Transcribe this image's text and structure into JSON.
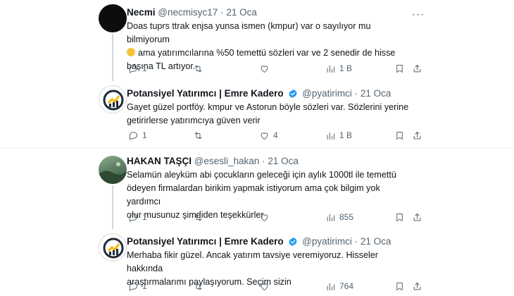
{
  "tweets": [
    {
      "name": "Necmi",
      "handle": "@necmisyc17",
      "sep": "·",
      "date": "21 Oca",
      "avatar": "black-avatar",
      "text_lines": [
        "Doas tuprs ttrak enjsa yunsa ismen (kmpur) var o sayılıyor mu bilmiyorum",
        "ama yatırımcılarına %50 temettü sözleri var ve 2 senedir de hisse",
        "başına TL artıyor."
      ],
      "emoji": "grinning-sweat-emoji",
      "reply_count": "1",
      "retweet_count": "",
      "like_count": "",
      "view_count": "1 B"
    },
    {
      "name": "Potansiyel Yatırımcı | Emre Kadero",
      "handle": "@pyatirimci",
      "sep": "·",
      "date": "21 Oca",
      "avatar": "logo-avatar",
      "verified": true,
      "text_lines": [
        "Gayet güzel portföy. kmpur ve Astorun böyle sözleri var. Sözlerini yerine",
        "getirirlerse yatırımcıya güven verir"
      ],
      "reply_count": "1",
      "retweet_count": "",
      "like_count": "4",
      "view_count": "1 B"
    },
    {
      "name": "HAKAN TAŞÇI",
      "handle": "@esesli_hakan",
      "sep": "·",
      "date": "21 Oca",
      "avatar": "landscape-avatar",
      "text_lines": [
        "Selamün aleyküm abi çocukların geleceği için aylık 1000tl ile temettü",
        "ödeyen firmalardan birikim yapmak istiyorum ama çok bilgim yok yardımcı",
        "olur musunuz şimdiden teşekkürler"
      ],
      "reply_count": "1",
      "retweet_count": "",
      "like_count": "",
      "view_count": "855"
    },
    {
      "name": "Potansiyel Yatırımcı | Emre Kadero",
      "handle": "@pyatirimci",
      "sep": "·",
      "date": "21 Oca",
      "avatar": "logo-avatar",
      "verified": true,
      "text_lines": [
        "Merhaba fikir güzel. Ancak yatırım tavsiye veremiyoruz. Hisseler hakkında",
        "araştırmalarımı paylaşıyorum. Seçim sizin"
      ],
      "reply_count": "1",
      "retweet_count": "",
      "like_count": "",
      "view_count": "764"
    }
  ],
  "more_label": "···",
  "colors": {
    "text": "#0f1419",
    "muted": "#536471",
    "verified": "#1d9bf0",
    "divider": "#eff3f4"
  }
}
